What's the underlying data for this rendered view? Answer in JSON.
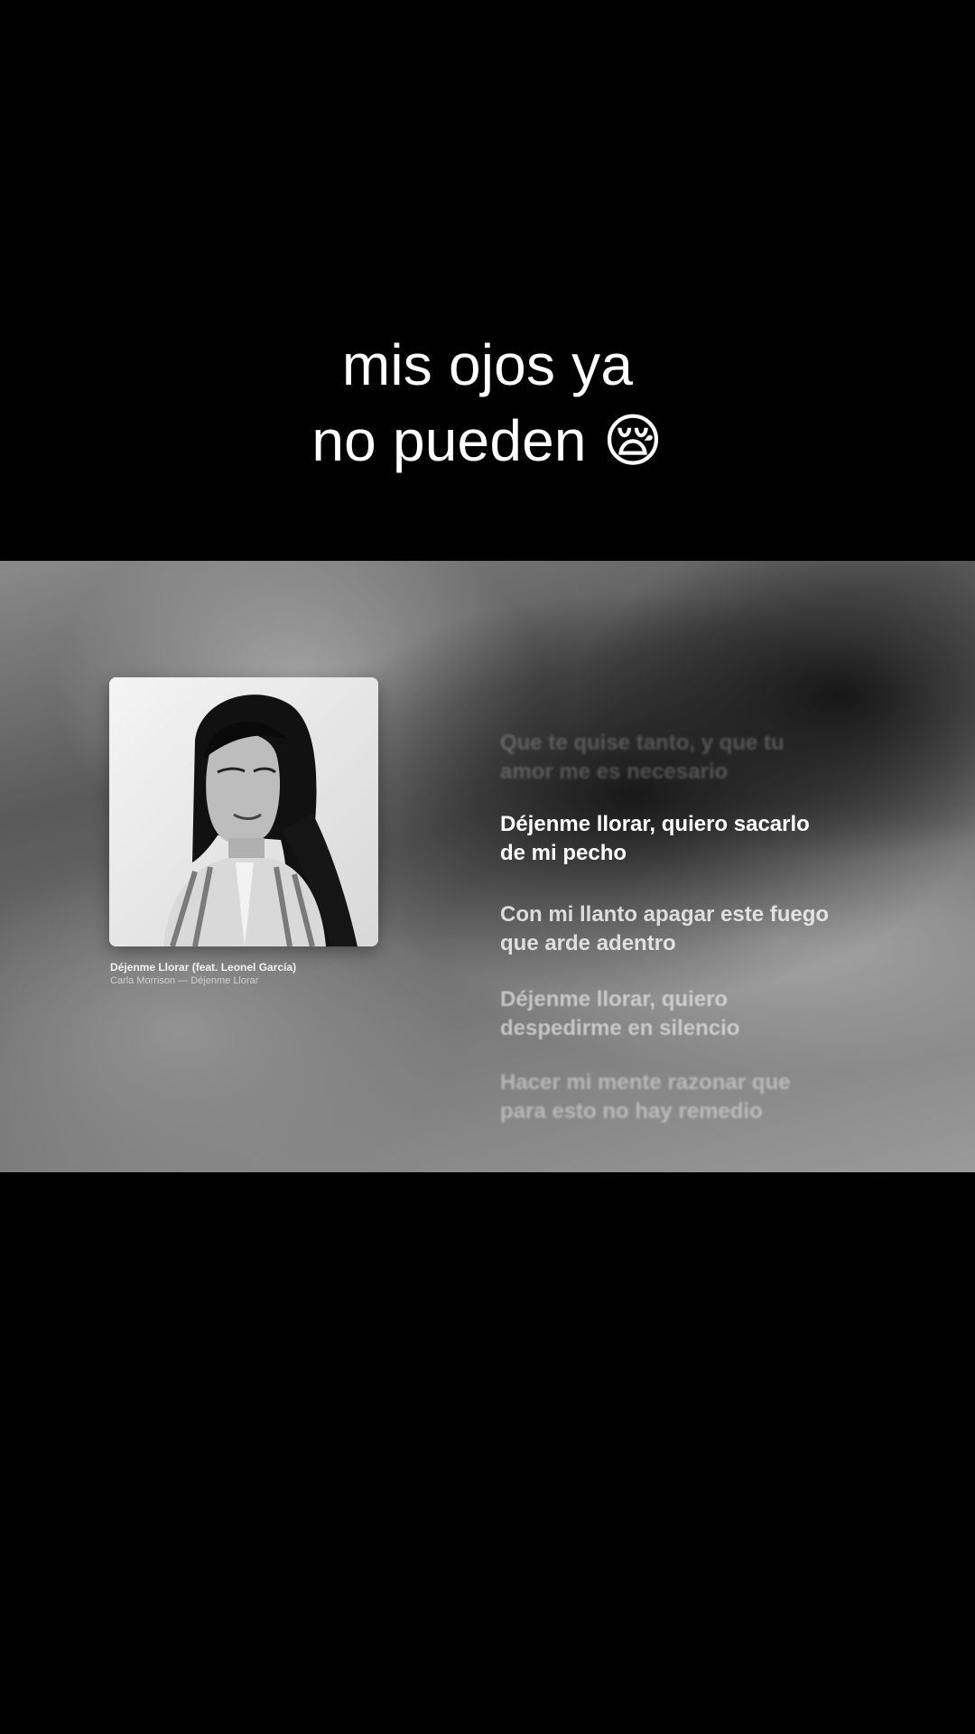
{
  "overlay_caption": {
    "line1": "mis ojos ya",
    "line2": "no pueden 😪"
  },
  "now_playing": {
    "track_title": "Déjenme Llorar (feat. Leonel García)",
    "artist_album": "Carla Morrison — Déjenme Llorar"
  },
  "lyrics": [
    {
      "text": "Que te quise tanto, y que tu\namor me es necesario",
      "state": "past"
    },
    {
      "text": "Déjenme llorar, quiero sacarlo\nde mi pecho",
      "state": "current"
    },
    {
      "text": "Con mi llanto apagar este fuego\nque arde adentro",
      "state": "upcoming"
    },
    {
      "text": "Déjenme llorar, quiero\ndespedirme en silencio",
      "state": "upcoming"
    },
    {
      "text": "Hacer mi mente razonar que\npara esto no hay remedio",
      "state": "upcoming"
    }
  ]
}
